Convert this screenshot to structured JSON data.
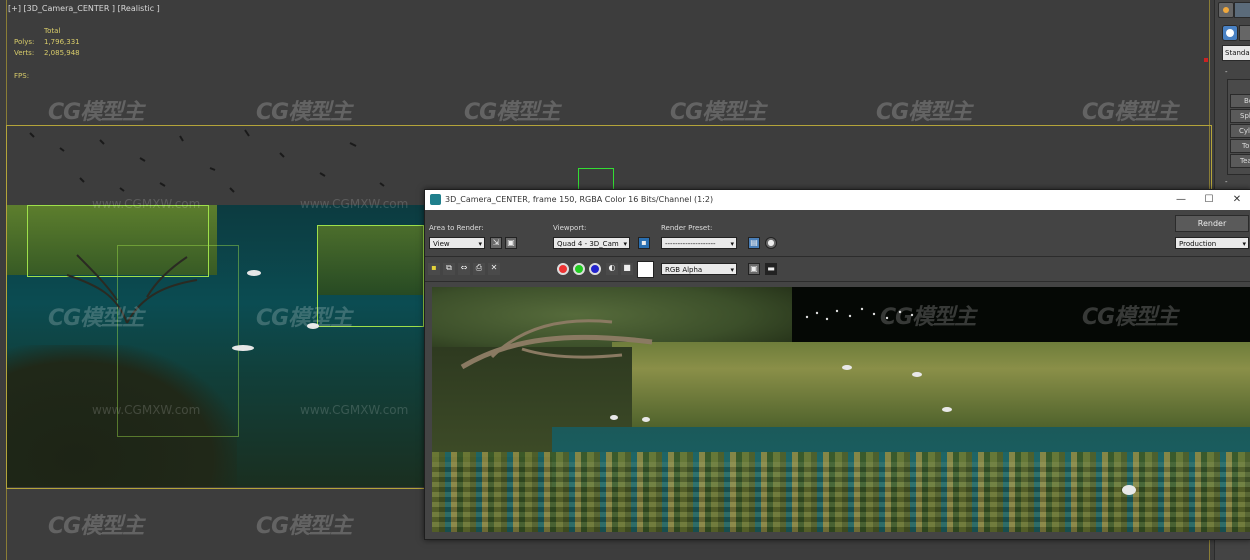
{
  "viewport": {
    "label": "[+] [3D_Camera_CENTER ] [Realistic ]",
    "stats": {
      "header": "Total",
      "polys_label": "Polys:",
      "polys_value": "1,796,331",
      "verts_label": "Verts:",
      "verts_value": "2,085,948",
      "fps_label": "FPS:"
    }
  },
  "watermark": {
    "logo": "CG模型主",
    "url": "www.CGMXW.com"
  },
  "render_window": {
    "title": "3D_Camera_CENTER, frame 150, RGBA Color 16 Bits/Channel (1:2)",
    "area_to_render_label": "Area to Render:",
    "area_to_render_value": "View",
    "viewport_label": "Viewport:",
    "viewport_value": "Quad 4 - 3D_Cam",
    "render_preset_label": "Render Preset:",
    "render_preset_value": "--------------------",
    "render_button": "Render",
    "production_value": "Production",
    "channel_value": "RGB Alpha",
    "minimize": "—",
    "maximize": "☐",
    "close": "✕"
  },
  "command_panel": {
    "dropdown": "Standard",
    "items": [
      "Bo",
      "Sph",
      "Cyli",
      "To",
      "Tea"
    ]
  },
  "colors": {
    "frame_border": "#b4a43a",
    "stats_text": "#d8cc6a",
    "wireframe": "#9ee04a"
  }
}
